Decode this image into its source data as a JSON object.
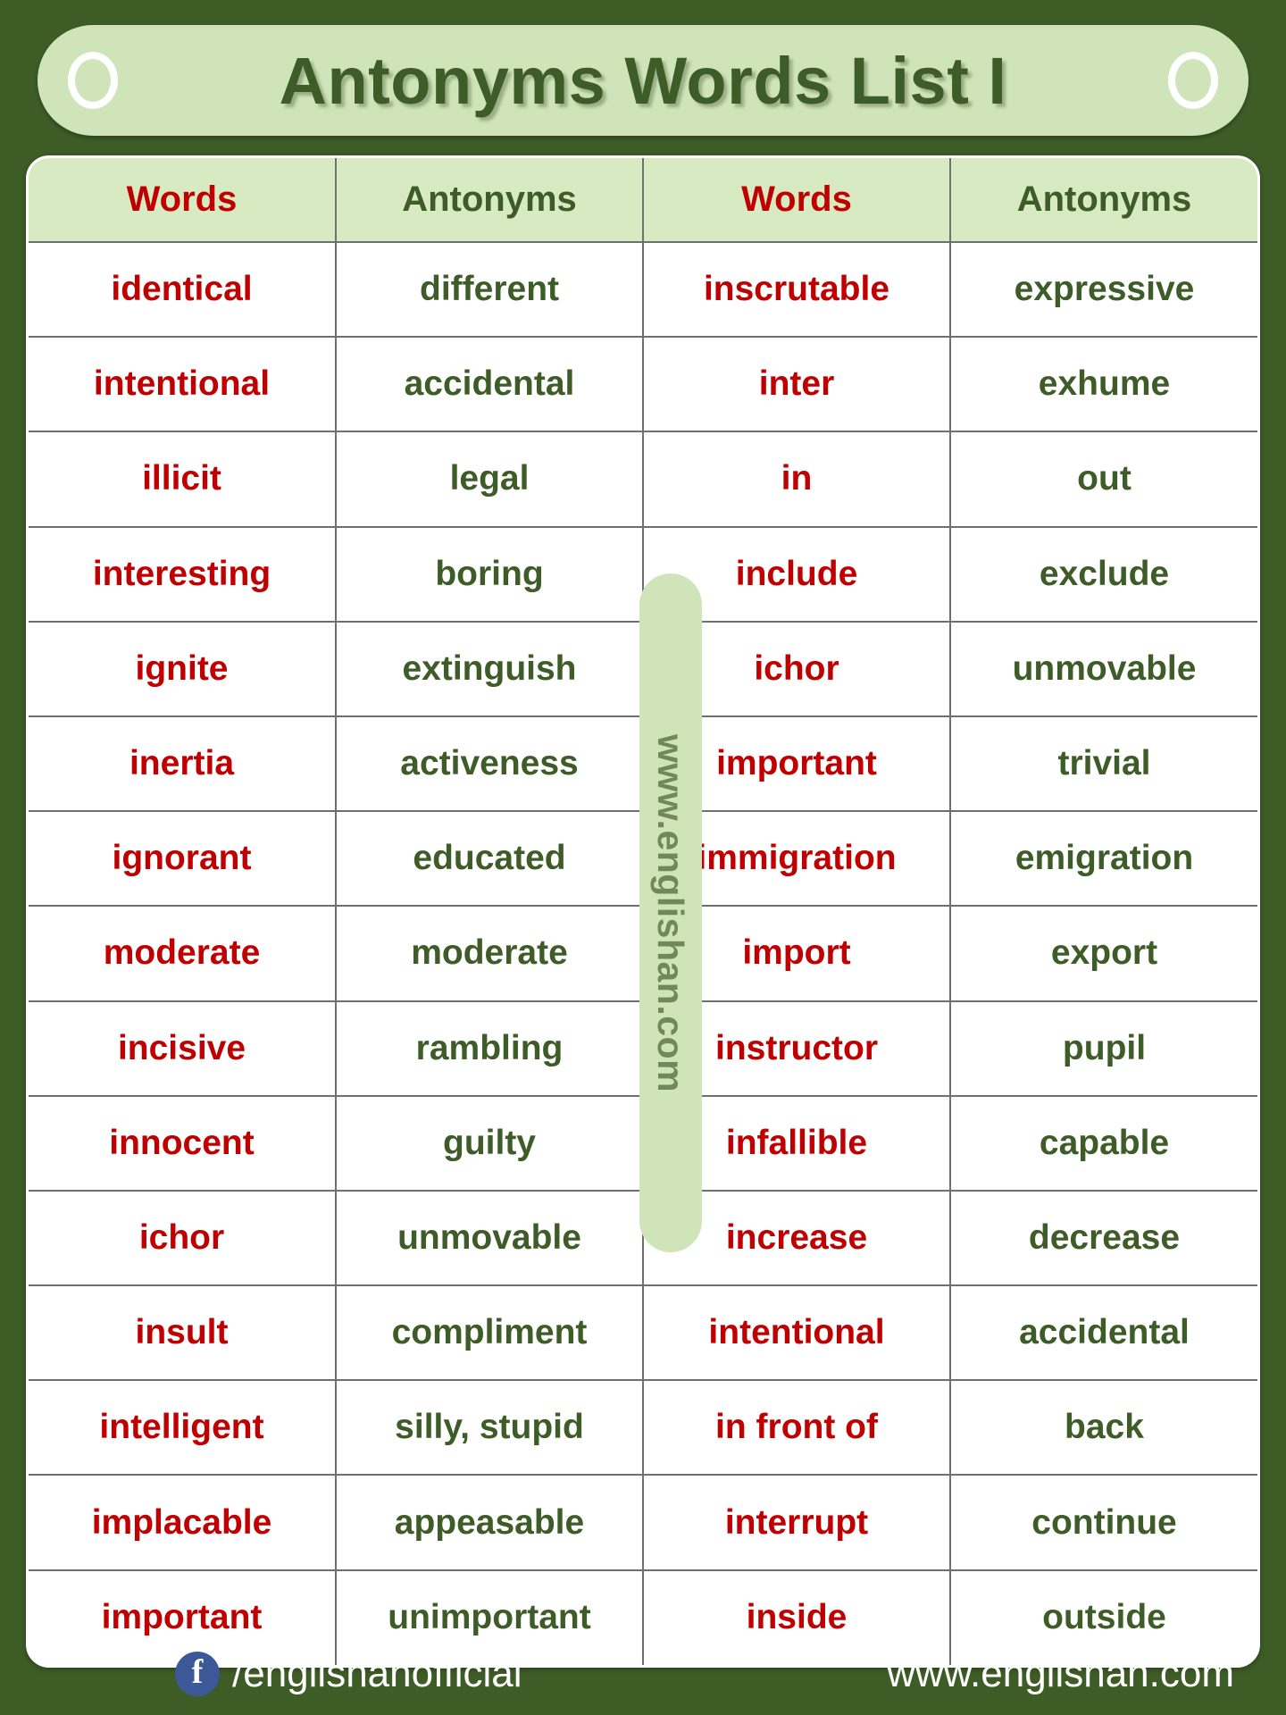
{
  "title": "Antonyms Words  List I",
  "watermark": "www.englishan.com",
  "theme": {
    "background_green": "#3d5c26",
    "panel_green": "#cfe5b9",
    "header_green": "#d7eac1",
    "word_red": "#c00000",
    "antonym_green": "#3e5c27",
    "facebook_blue": "#3b5998"
  },
  "table": {
    "headers": [
      "Words",
      "Antonyms",
      "Words",
      "Antonyms"
    ],
    "rows": [
      [
        "identical",
        "different",
        "inscrutable",
        "expressive"
      ],
      [
        "intentional",
        "accidental",
        "inter",
        "exhume"
      ],
      [
        "illicit",
        "legal",
        "in",
        "out"
      ],
      [
        "interesting",
        "boring",
        "include",
        "exclude"
      ],
      [
        "ignite",
        "extinguish",
        "ichor",
        "unmovable"
      ],
      [
        "inertia",
        "activeness",
        "important",
        "trivial"
      ],
      [
        "ignorant",
        "educated",
        "immigration",
        "emigration"
      ],
      [
        "moderate",
        "moderate",
        "import",
        "export"
      ],
      [
        "incisive",
        "rambling",
        "instructor",
        "pupil"
      ],
      [
        "innocent",
        "guilty",
        "infallible",
        "capable"
      ],
      [
        "ichor",
        "unmovable",
        "increase",
        "decrease"
      ],
      [
        "insult",
        "compliment",
        "intentional",
        "accidental"
      ],
      [
        "intelligent",
        "silly, stupid",
        "in front of",
        "back"
      ],
      [
        "implacable",
        "appeasable",
        "interrupt",
        "continue"
      ],
      [
        "important",
        "unimportant",
        "inside",
        "outside"
      ]
    ]
  },
  "footer": {
    "facebook_glyph": "f",
    "facebook_handle": "/englishanofficial",
    "website": "www.englishan.com"
  }
}
